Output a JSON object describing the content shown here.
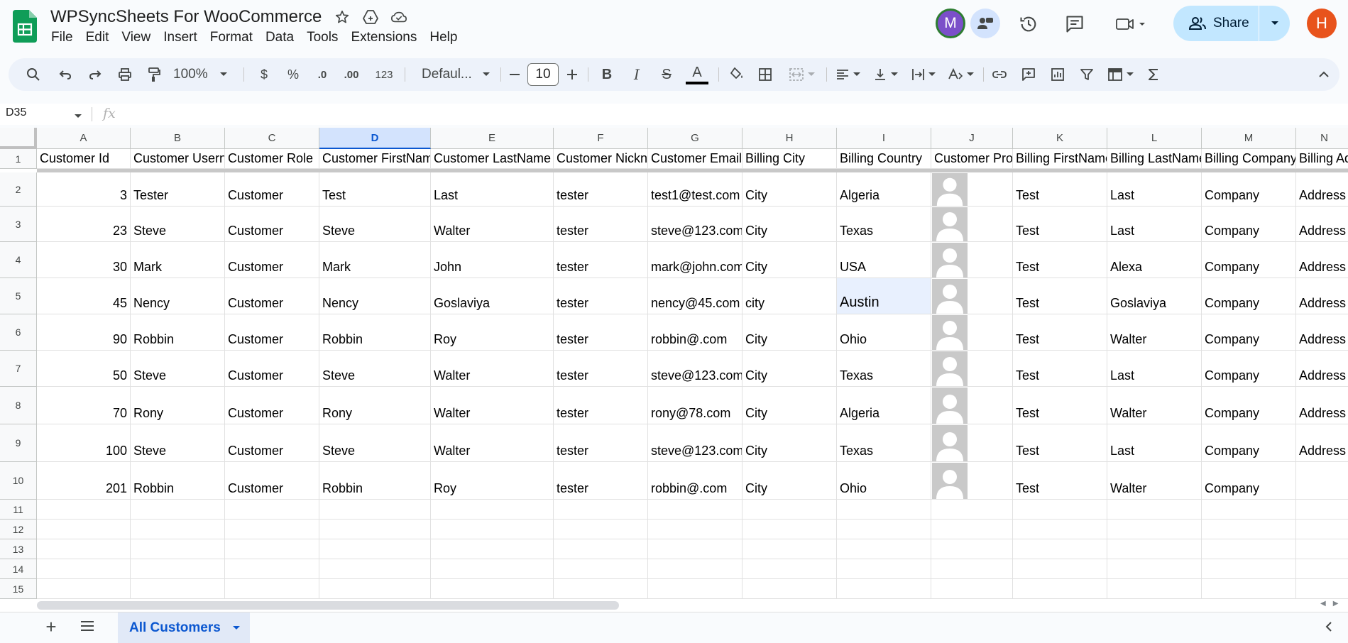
{
  "doc": {
    "title": "WPSyncSheets For WooCommerce"
  },
  "menu": [
    "File",
    "Edit",
    "View",
    "Insert",
    "Format",
    "Data",
    "Tools",
    "Extensions",
    "Help"
  ],
  "header": {
    "avatar_m": "M",
    "avatar_h": "H",
    "share_label": "Share",
    "avatar_m_color": "#7b4fc9",
    "avatar_h_color": "#e8531c"
  },
  "toolbar": {
    "zoom": "100%",
    "currency": "$",
    "percent": "%",
    "decrease_decimal": ".0",
    "increase_decimal": ".00",
    "number_format": "123",
    "font_family": "Defaul...",
    "font_size": "10",
    "bold": "B",
    "italic": "I",
    "strike": "S",
    "text_color": "A"
  },
  "formula_bar": {
    "name_box": "D35",
    "fx": "fx"
  },
  "grid": {
    "columns": [
      "A",
      "B",
      "C",
      "D",
      "E",
      "F",
      "G",
      "H",
      "I",
      "J",
      "K",
      "L",
      "M",
      "N"
    ],
    "selected_column": "D",
    "headers": [
      "Customer Id",
      "Customer Usern",
      "Customer Role",
      "Customer FirstNam",
      "Customer LastName",
      "Customer Nickn",
      "Customer Emaill",
      "Billing City",
      "Billing Country",
      "Customer Pro",
      "Billing FirstName",
      "Billing LastName",
      "Billing Company",
      "Billing Ad"
    ],
    "rows": [
      {
        "num": "2",
        "cells": [
          "3",
          "Tester",
          "Customer",
          "Test",
          "Last",
          "tester",
          "test1@test.com",
          "City",
          "Algeria",
          "",
          "Test",
          "Last",
          "Company",
          "Address"
        ]
      },
      {
        "num": "3",
        "cells": [
          "23",
          "Steve",
          "Customer",
          "Steve",
          "Walter",
          "tester",
          "steve@123.com",
          "City",
          "Texas",
          "",
          "Test",
          "Last",
          "Company",
          "Address"
        ]
      },
      {
        "num": "4",
        "cells": [
          "30",
          "Mark",
          "Customer",
          "Mark",
          "John",
          "tester",
          "mark@john.com",
          "City",
          "USA",
          "",
          "Test",
          "Alexa",
          "Company",
          "Address"
        ]
      },
      {
        "num": "5",
        "cells": [
          "45",
          "Nency",
          "Customer",
          "Nency",
          "Goslaviya",
          "tester",
          "nency@45.com",
          "city",
          "Austin",
          "",
          "Test",
          "Goslaviya",
          "Company",
          "Address"
        ]
      },
      {
        "num": "6",
        "cells": [
          "90",
          "Robbin",
          "Customer",
          "Robbin",
          "Roy",
          "tester",
          "robbin@.com",
          "City",
          "Ohio",
          "",
          "Test",
          "Walter",
          "Company",
          "Address"
        ]
      },
      {
        "num": "7",
        "cells": [
          "50",
          "Steve",
          "Customer",
          "Steve",
          "Walter",
          "tester",
          "steve@123.com",
          "City",
          "Texas",
          "",
          "Test",
          "Last",
          "Company",
          "Address"
        ]
      },
      {
        "num": "8",
        "cells": [
          "70",
          "Rony",
          "Customer",
          "Rony",
          "Walter",
          "tester",
          "rony@78.com",
          "City",
          "Algeria",
          "",
          "Test",
          "Walter",
          "Company",
          "Address"
        ]
      },
      {
        "num": "9",
        "cells": [
          "100",
          "Steve",
          "Customer",
          "Steve",
          "Walter",
          "tester",
          "steve@123.com",
          "City",
          "Texas",
          "",
          "Test",
          "Last",
          "Company",
          "Address"
        ]
      },
      {
        "num": "10",
        "cells": [
          "201",
          "Robbin",
          "Customer",
          "Robbin",
          "Roy",
          "tester",
          "robbin@.com",
          "City",
          "Ohio",
          "",
          "Test",
          "Walter",
          "Company",
          ""
        ]
      }
    ],
    "empty_rows": [
      "11",
      "12",
      "13",
      "14",
      "15"
    ],
    "header_row_num": "1"
  },
  "sheets": {
    "active_tab": "All Customers",
    "accent": "#0b57d0"
  }
}
